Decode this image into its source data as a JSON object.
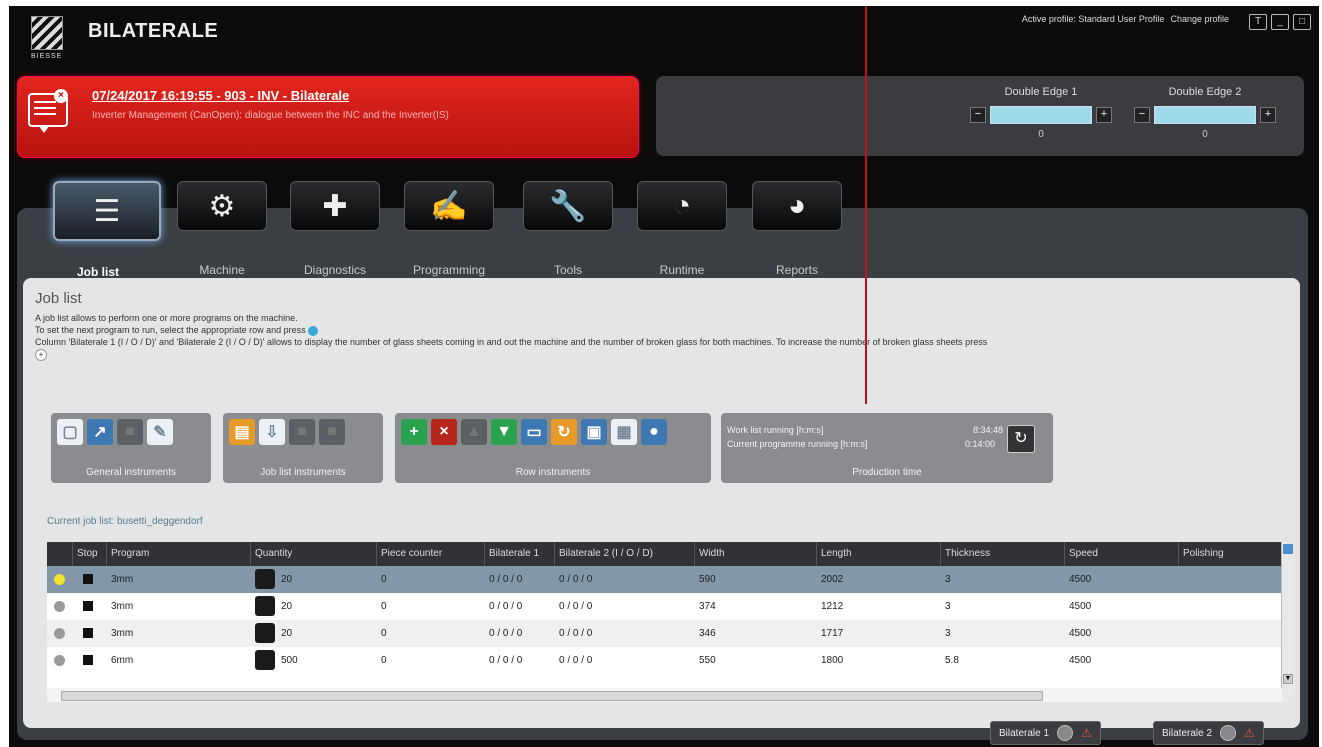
{
  "app": {
    "title": "BILATERALE",
    "logo_text": "BIESSE"
  },
  "profile": {
    "active": "Active profile: Standard User Profile",
    "change": "Change profile"
  },
  "window_buttons": [
    "T",
    "_",
    "□"
  ],
  "alarm": {
    "title": "07/24/2017 16:19:55 - 903 - INV - Bilaterale",
    "description": "Inverter Management (CanOpen): dialogue between the INC and the Inverter(IS)"
  },
  "edges": [
    {
      "label": "Double Edge 1",
      "value": "0"
    },
    {
      "label": "Double Edge 2",
      "value": "0"
    }
  ],
  "tabs": [
    {
      "label": "Job list",
      "icon": "joblist-icon",
      "glyph": "☰"
    },
    {
      "label": "Machine",
      "icon": "gears-icon",
      "glyph": "⚙"
    },
    {
      "label": "Diagnostics",
      "icon": "medical-cross-icon",
      "glyph": "✚"
    },
    {
      "label": "Programming",
      "icon": "programmer-icon",
      "glyph": "✍"
    },
    {
      "label": "Tools",
      "icon": "wrench-icon",
      "glyph": "🔧"
    },
    {
      "label": "Runtime",
      "icon": "gauge-icon",
      "glyph": "◔"
    },
    {
      "label": "Reports",
      "icon": "pie-chart-icon",
      "glyph": "◕"
    }
  ],
  "page": {
    "title": "Job list",
    "desc1": "A job list allows to perform one or more programs on the machine.",
    "desc2": "To set the next program to run, select the appropriate row and press",
    "desc3": "Column 'Bilaterale 1 (I / O / D)' and 'Bilaterale 2 (I / O / D)' allows to display the number of glass sheets coming in and out the machine and the number of broken glass for both machines. To increase the number of broken glass sheets press"
  },
  "groups": {
    "general": "General instruments",
    "joblist": "Job list instruments",
    "row": "Row instruments"
  },
  "production": {
    "caption": "Production time",
    "work_label": "Work list running [h:m:s]",
    "work_value": "8:34:48",
    "prog_label": "Current programme running [h:m:s]",
    "prog_value": "0:14:00"
  },
  "current_job": "Current job list: busetti_deggendorf",
  "table": {
    "headers": [
      "",
      "Stop",
      "Program",
      "Quantity",
      "Piece counter",
      "Bilaterale 1",
      "Bilaterale 2 (I / O / D)",
      "Width",
      "Length",
      "Thickness",
      "Speed",
      "Polishing"
    ],
    "rows": [
      [
        "3mm",
        "20",
        "0",
        "0 / 0 / 0",
        "0 / 0 / 0",
        "590",
        "2002",
        "3",
        "4500"
      ],
      [
        "3mm",
        "20",
        "0",
        "0 / 0 / 0",
        "0 / 0 / 0",
        "374",
        "1212",
        "3",
        "4500"
      ],
      [
        "3mm",
        "20",
        "0",
        "0 / 0 / 0",
        "0 / 0 / 0",
        "346",
        "1717",
        "3",
        "4500"
      ],
      [
        "6mm",
        "500",
        "0",
        "0 / 0 / 0",
        "0 / 0 / 0",
        "550",
        "1800",
        "5.8",
        "4500"
      ]
    ]
  },
  "status": {
    "m1": "Bilaterale 1",
    "m2": "Bilaterale 2"
  }
}
